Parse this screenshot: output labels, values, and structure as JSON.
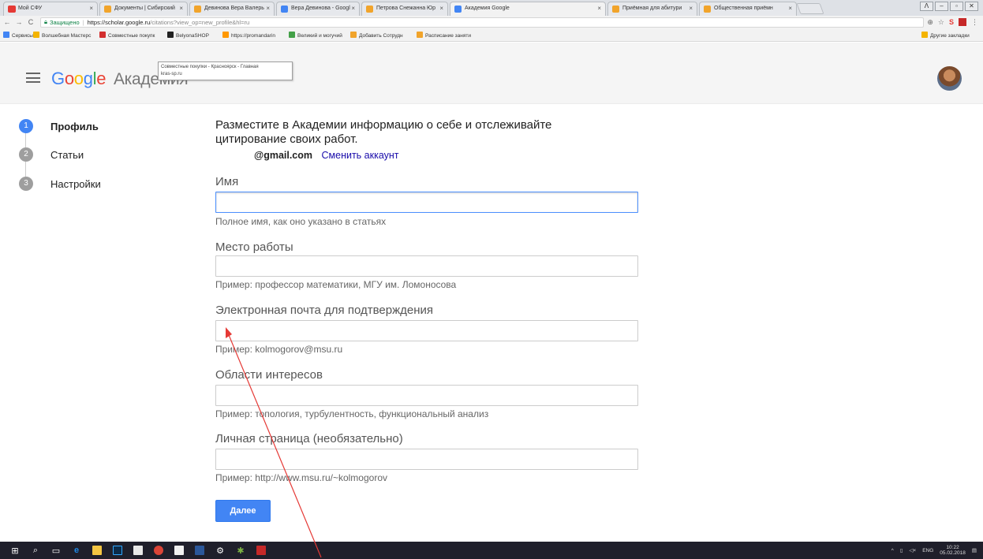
{
  "browser": {
    "tabs": [
      {
        "label": "Мой СФУ",
        "icon": "sfu-icon"
      },
      {
        "label": "Документы | Сибирский",
        "icon": "doc-icon"
      },
      {
        "label": "Девинова Вера Валерь",
        "icon": "doc-icon"
      },
      {
        "label": "Вера Девинова - Googl",
        "icon": "scholar-icon"
      },
      {
        "label": "Петрова Снежанна Юр",
        "icon": "doc-icon"
      },
      {
        "label": "Академия Google",
        "icon": "scholar-icon",
        "active": true
      },
      {
        "label": "Приёмная для абитури",
        "icon": "doc-icon"
      },
      {
        "label": "Общественная приёмн",
        "icon": "doc-icon"
      }
    ],
    "secure_label": "Защищено",
    "url_host": "https://scholar.google.ru",
    "url_path": "/citations?view_op=new_profile&hl=ru",
    "bookmarks": [
      "Сервисы",
      "Волшебная Мастерс",
      "Совместные покупк",
      "BelyonaSHOP",
      "https://promandarin",
      "Великий и могучий",
      "Добавить Сотрудн",
      "Расписание заняти"
    ],
    "other_bookmarks": "Другие закладки",
    "tooltip_line1": "Совместные покупки - Красноярск - Главная",
    "tooltip_line2": "kras-sp.ru"
  },
  "header": {
    "logo_google": "Google",
    "logo_suffix": "Академия"
  },
  "steps": [
    {
      "num": "1",
      "label": "Профиль",
      "active": true
    },
    {
      "num": "2",
      "label": "Статьи",
      "active": false
    },
    {
      "num": "3",
      "label": "Настройки",
      "active": false
    }
  ],
  "form": {
    "intro": "Разместите в Академии информацию о себе и отслеживайте цитирование своих работ.",
    "account_email": "@gmail.com",
    "switch_account": "Сменить аккаунт",
    "fields": [
      {
        "label": "Имя",
        "value": "",
        "hint": "Полное имя, как оно указано в статьях"
      },
      {
        "label": "Место работы",
        "value": "",
        "hint": "Пример: профессор математики, МГУ им. Ломоносова"
      },
      {
        "label": "Электронная почта для подтверждения",
        "value": "",
        "hint": "Пример: kolmogorov@msu.ru"
      },
      {
        "label": "Области интересов",
        "value": "",
        "hint": "Пример: топология, турбулентность, функциональный анализ"
      },
      {
        "label": "Личная страница (необязательно)",
        "value": "",
        "hint": "Пример: http://www.msu.ru/~kolmogorov"
      }
    ],
    "next_button": "Далее"
  },
  "taskbar": {
    "lang": "ENG",
    "time": "10:22",
    "date": "05.02.2018"
  },
  "colors": {
    "accent": "#4285f4",
    "annotation_arrow": "#e53935"
  }
}
